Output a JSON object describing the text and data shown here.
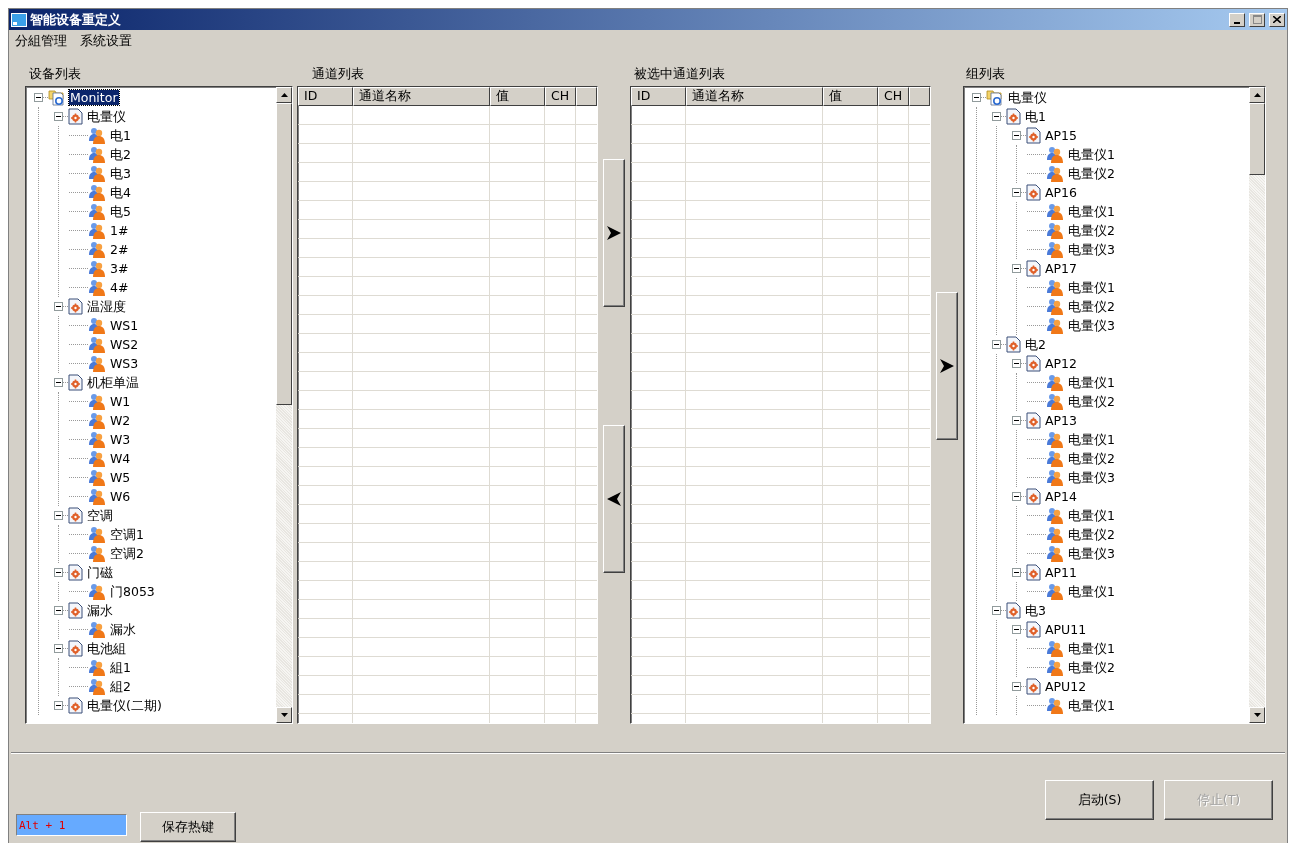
{
  "window": {
    "title": "智能设备重定义"
  },
  "menu": [
    "分組管理",
    "系统设置"
  ],
  "device_panel": {
    "label": "设备列表",
    "tree": [
      {
        "label": "Monitor",
        "kind": "root",
        "selected": true,
        "expanded": true,
        "children": [
          {
            "label": "电量仪",
            "kind": "group",
            "selected": false,
            "expanded": true,
            "children": [
              {
                "label": "电1",
                "kind": "device",
                "selected": false
              },
              {
                "label": "电2",
                "kind": "device",
                "selected": false
              },
              {
                "label": "电3",
                "kind": "device",
                "selected": false
              },
              {
                "label": "电4",
                "kind": "device",
                "selected": false
              },
              {
                "label": "电5",
                "kind": "device",
                "selected": false
              },
              {
                "label": "1#",
                "kind": "device",
                "selected": false
              },
              {
                "label": "2#",
                "kind": "device",
                "selected": false
              },
              {
                "label": "3#",
                "kind": "device",
                "selected": false
              },
              {
                "label": "4#",
                "kind": "device",
                "selected": false
              }
            ]
          },
          {
            "label": "温湿度",
            "kind": "group",
            "selected": false,
            "expanded": true,
            "children": [
              {
                "label": "WS1",
                "kind": "device",
                "selected": false
              },
              {
                "label": "WS2",
                "kind": "device",
                "selected": false
              },
              {
                "label": "WS3",
                "kind": "device",
                "selected": false
              }
            ]
          },
          {
            "label": "机柜单温",
            "kind": "group",
            "selected": false,
            "expanded": true,
            "children": [
              {
                "label": "W1",
                "kind": "device",
                "selected": false
              },
              {
                "label": "W2",
                "kind": "device",
                "selected": false
              },
              {
                "label": "W3",
                "kind": "device",
                "selected": false
              },
              {
                "label": "W4",
                "kind": "device",
                "selected": false
              },
              {
                "label": "W5",
                "kind": "device",
                "selected": false
              },
              {
                "label": "W6",
                "kind": "device",
                "selected": false
              }
            ]
          },
          {
            "label": "空调",
            "kind": "group",
            "selected": false,
            "expanded": true,
            "children": [
              {
                "label": "空调1",
                "kind": "device",
                "selected": false
              },
              {
                "label": "空调2",
                "kind": "device",
                "selected": false
              }
            ]
          },
          {
            "label": "门磁",
            "kind": "group",
            "selected": false,
            "expanded": true,
            "children": [
              {
                "label": "门8053",
                "kind": "device",
                "selected": false
              }
            ]
          },
          {
            "label": "漏水",
            "kind": "group",
            "selected": false,
            "expanded": true,
            "children": [
              {
                "label": "漏水",
                "kind": "device",
                "selected": false
              }
            ]
          },
          {
            "label": "电池組",
            "kind": "group",
            "selected": false,
            "expanded": true,
            "children": [
              {
                "label": "組1",
                "kind": "device",
                "selected": false
              },
              {
                "label": "組2",
                "kind": "device",
                "selected": false
              }
            ]
          },
          {
            "label": "电量仪(二期)",
            "kind": "group",
            "selected": false,
            "expanded": true
          }
        ]
      }
    ]
  },
  "channel_panel": {
    "label": "通道列表",
    "columns": [
      "ID",
      "通道名称",
      "值",
      "CH"
    ]
  },
  "transfer_buttons": [
    {
      "kind": "right"
    },
    {
      "kind": "left"
    }
  ],
  "selected_channel_panel": {
    "label": "被选中通道列表",
    "columns": [
      "ID",
      "通道名称",
      "值",
      "CH"
    ]
  },
  "group_transfer_button": {
    "kind": "right"
  },
  "group_panel": {
    "label": "组列表",
    "tree": [
      {
        "label": "电量仪",
        "kind": "root",
        "selected": false,
        "expanded": true,
        "children": [
          {
            "label": "电1",
            "kind": "group",
            "selected": false,
            "expanded": true,
            "children": [
              {
                "label": "AP15",
                "kind": "group",
                "selected": false,
                "expanded": true,
                "children": [
                  {
                    "label": "电量仪1",
                    "kind": "device",
                    "selected": false
                  },
                  {
                    "label": "电量仪2",
                    "kind": "device",
                    "selected": false
                  }
                ]
              },
              {
                "label": "AP16",
                "kind": "group",
                "selected": false,
                "expanded": true,
                "children": [
                  {
                    "label": "电量仪1",
                    "kind": "device",
                    "selected": false
                  },
                  {
                    "label": "电量仪2",
                    "kind": "device",
                    "selected": false
                  },
                  {
                    "label": "电量仪3",
                    "kind": "device",
                    "selected": false
                  }
                ]
              },
              {
                "label": "AP17",
                "kind": "group",
                "selected": false,
                "expanded": true,
                "children": [
                  {
                    "label": "电量仪1",
                    "kind": "device",
                    "selected": false
                  },
                  {
                    "label": "电量仪2",
                    "kind": "device",
                    "selected": false
                  },
                  {
                    "label": "电量仪3",
                    "kind": "device",
                    "selected": false
                  }
                ]
              }
            ]
          },
          {
            "label": "电2",
            "kind": "group",
            "selected": false,
            "expanded": true,
            "children": [
              {
                "label": "AP12",
                "kind": "group",
                "selected": false,
                "expanded": true,
                "children": [
                  {
                    "label": "电量仪1",
                    "kind": "device",
                    "selected": false
                  },
                  {
                    "label": "电量仪2",
                    "kind": "device",
                    "selected": false
                  }
                ]
              },
              {
                "label": "AP13",
                "kind": "group",
                "selected": false,
                "expanded": true,
                "children": [
                  {
                    "label": "电量仪1",
                    "kind": "device",
                    "selected": false
                  },
                  {
                    "label": "电量仪2",
                    "kind": "device",
                    "selected": false
                  },
                  {
                    "label": "电量仪3",
                    "kind": "device",
                    "selected": false
                  }
                ]
              },
              {
                "label": "AP14",
                "kind": "group",
                "selected": false,
                "expanded": true,
                "children": [
                  {
                    "label": "电量仪1",
                    "kind": "device",
                    "selected": false
                  },
                  {
                    "label": "电量仪2",
                    "kind": "device",
                    "selected": false
                  },
                  {
                    "label": "电量仪3",
                    "kind": "device",
                    "selected": false
                  }
                ]
              },
              {
                "label": "AP11",
                "kind": "group",
                "selected": false,
                "expanded": true,
                "children": [
                  {
                    "label": "电量仪1",
                    "kind": "device",
                    "selected": false
                  }
                ]
              }
            ]
          },
          {
            "label": "电3",
            "kind": "group",
            "selected": false,
            "expanded": true,
            "children": [
              {
                "label": "APU11",
                "kind": "group",
                "selected": false,
                "expanded": true,
                "children": [
                  {
                    "label": "电量仪1",
                    "kind": "device",
                    "selected": false
                  },
                  {
                    "label": "电量仪2",
                    "kind": "device",
                    "selected": false
                  }
                ]
              },
              {
                "label": "APU12",
                "kind": "group",
                "selected": false,
                "expanded": true,
                "children": [
                  {
                    "label": "电量仪1",
                    "kind": "device",
                    "selected": false
                  }
                ]
              }
            ]
          }
        ]
      }
    ]
  },
  "hotkey_field": {
    "value": "Alt + 1"
  },
  "save_hotkey_button": {
    "label": "保存热键",
    "disabled": false
  },
  "actions": [
    {
      "label": "启动(S)",
      "disabled": false
    },
    {
      "label": "停止(T)",
      "disabled": true
    }
  ]
}
